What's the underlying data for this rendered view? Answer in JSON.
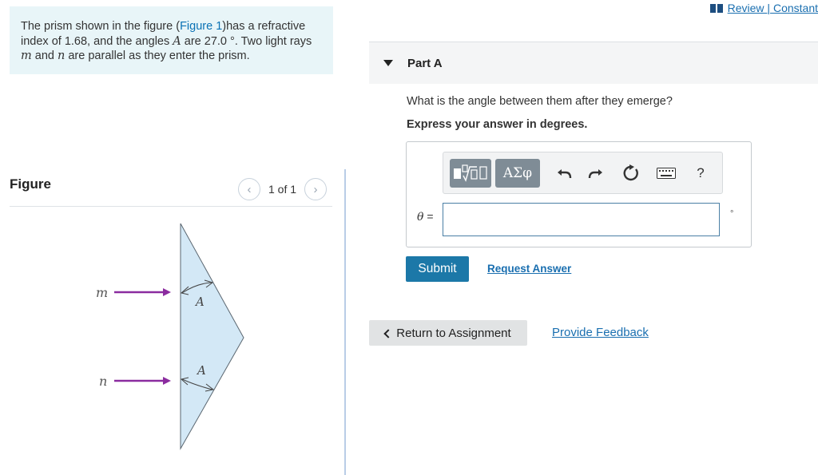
{
  "header": {
    "review_link": "Review | Constant"
  },
  "problem": {
    "text_before_link": "The prism shown in the figure (",
    "figure_link": "Figure 1",
    "text_after_link": ")has a refractive index of 1.68, and the angles ",
    "angle_symbol": "A",
    "text_after_angle": " are 27.0 °. Two light rays ",
    "ray_m": "m",
    "text_and": " and ",
    "ray_n": "n",
    "text_end": " are parallel as they enter the prism."
  },
  "figure": {
    "title": "Figure",
    "pager": "1 of 1",
    "prev_icon": "chevron-left-icon",
    "next_icon": "chevron-right-icon",
    "labels": {
      "ray_m": "m",
      "ray_n": "n",
      "angle_top": "A",
      "angle_bottom": "A"
    },
    "colors": {
      "prism_fill": "#d3e8f6",
      "ray": "#8b2c9f"
    }
  },
  "part": {
    "label": "Part A",
    "question": "What is the angle between them after they emerge?",
    "instruction": "Express your answer in degrees.",
    "toolbar": {
      "greek_label": "ΑΣφ",
      "help_label": "?",
      "icons": [
        "template-icon",
        "greek-letters-icon",
        "undo-icon",
        "redo-icon",
        "reset-icon",
        "keyboard-icon",
        "help-icon"
      ]
    },
    "variable_symbol": "θ",
    "equals": " =",
    "input_value": "",
    "unit": "°"
  },
  "actions": {
    "submit": "Submit",
    "request_answer": "Request Answer",
    "return": "Return to Assignment",
    "feedback": "Provide Feedback"
  },
  "colors": {
    "primary": "#1c78a8",
    "link": "#1a6fb0",
    "problem_bg": "#e8f5f8"
  }
}
